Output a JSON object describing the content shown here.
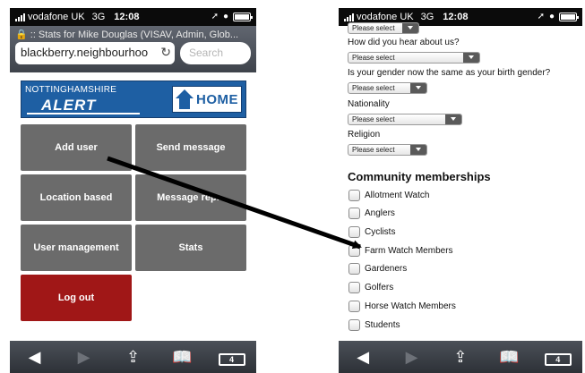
{
  "status_bar": {
    "carrier": "vodafone UK",
    "network": "3G",
    "time": "12:08"
  },
  "left_phone": {
    "page_title": ":: Stats for Mike Douglas (VISAV, Admin, Glob...",
    "url": "blackberry.neighbourhoo",
    "search_placeholder": "Search",
    "banner": {
      "logo_line1": "NOTTINGHAMSHIRE",
      "logo_line2": "ALERT",
      "home_label": "HOME"
    },
    "menu": [
      {
        "label": "Add user"
      },
      {
        "label": "Send message"
      },
      {
        "label": "Location based"
      },
      {
        "label": "Message rep..."
      },
      {
        "label": "User management"
      },
      {
        "label": "Stats"
      },
      {
        "label": "Log out"
      }
    ],
    "colors": {
      "menu_button": "#6b6b6b",
      "logout_button": "#a01717",
      "banner": "#1e5fa3"
    }
  },
  "right_phone": {
    "top_select": "Please select",
    "questions": [
      {
        "label": "How did you hear about us?",
        "select": "Please select"
      },
      {
        "label": "Is your gender now the same as your birth gender?",
        "select": "Please select"
      },
      {
        "label": "Nationality",
        "select": "Please select"
      },
      {
        "label": "Religion",
        "select": "Please select"
      }
    ],
    "section_title": "Community memberships",
    "memberships": [
      {
        "label": "Allotment Watch",
        "checked": false
      },
      {
        "label": "Anglers",
        "checked": false
      },
      {
        "label": "Cyclists",
        "checked": false
      },
      {
        "label": "Farm Watch Members",
        "checked": false
      },
      {
        "label": "Gardeners",
        "checked": false
      },
      {
        "label": "Golfers",
        "checked": false
      },
      {
        "label": "Horse Watch Members",
        "checked": false
      },
      {
        "label": "Students",
        "checked": false
      }
    ]
  },
  "toolbar_icons": [
    "back-icon",
    "forward-icon",
    "share-icon",
    "bookmarks-icon",
    "tabs-icon"
  ],
  "tabs_count": "4"
}
